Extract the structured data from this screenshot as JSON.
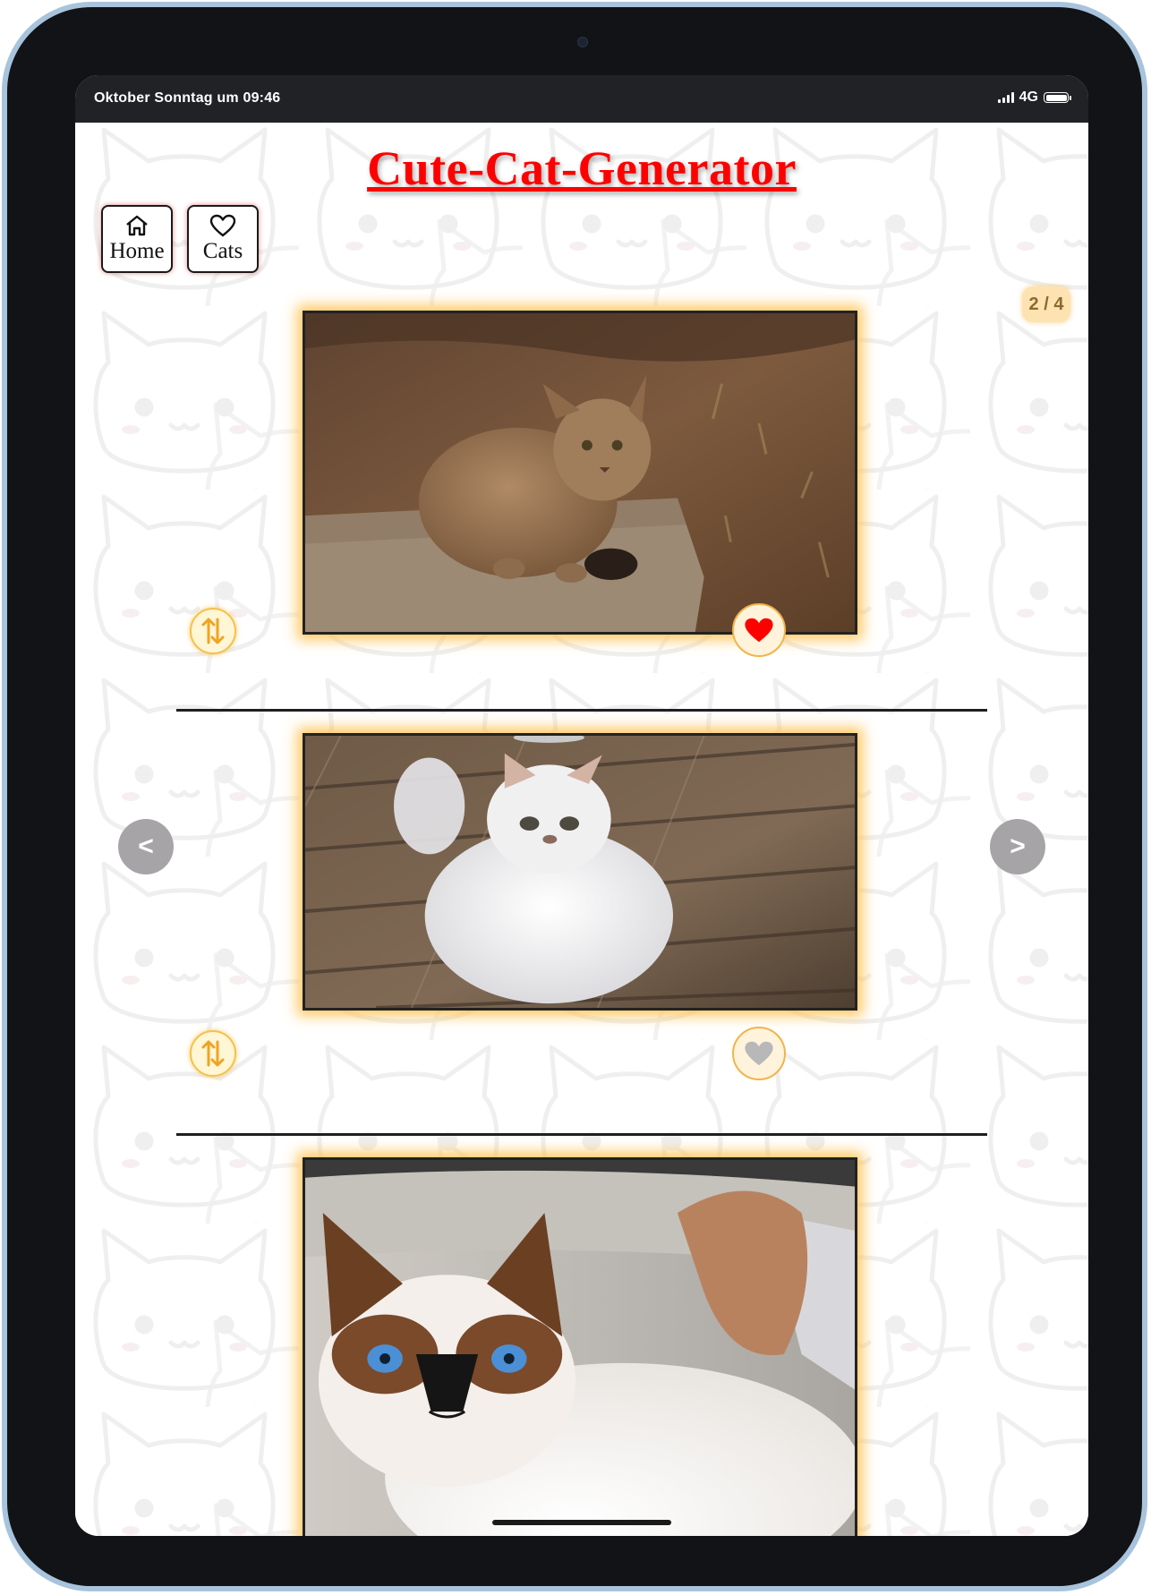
{
  "statusbar": {
    "time": "Oktober Sonntag um 09:46",
    "network": "4G"
  },
  "header": {
    "title": "Cute-Cat-Generator",
    "nav": [
      {
        "label": "Home",
        "icon": "home-icon"
      },
      {
        "label": "Cats",
        "icon": "heart-outline-icon"
      }
    ]
  },
  "carousel": {
    "counter": "2 / 4",
    "prev_label": "<",
    "next_label": ">"
  },
  "cards": [
    {
      "favorite": true,
      "photo": "abyssinian-cat-photo"
    },
    {
      "favorite": false,
      "photo": "persian-cat-photo"
    },
    {
      "favorite": false,
      "photo": "ragdoll-cat-photo"
    }
  ],
  "colors": {
    "title": "#ff0000",
    "glow": "#ffbe46",
    "heart_active": "#ff0000",
    "heart_inactive": "#b8b8b8",
    "arrow_bg": "#a7a4a8",
    "counter_bg": "#fde3b1"
  }
}
